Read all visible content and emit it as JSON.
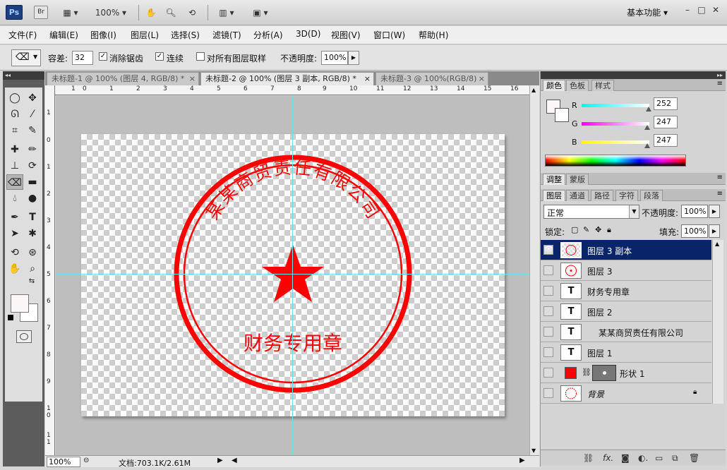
{
  "appbar": {
    "ps_logo": "Ps",
    "br_logo": "Br",
    "zoom": "100%",
    "workspace": "基本功能"
  },
  "menu": [
    "文件(F)",
    "编辑(E)",
    "图像(I)",
    "图层(L)",
    "选择(S)",
    "滤镜(T)",
    "分析(A)",
    "3D(D)",
    "视图(V)",
    "窗口(W)",
    "帮助(H)"
  ],
  "options": {
    "tolerance_label": "容差:",
    "tolerance_value": "32",
    "antialias_label": "消除锯齿",
    "contiguous_label": "连续",
    "sample_all_label": "对所有图层取样",
    "opacity_label": "不透明度:",
    "opacity_value": "100%"
  },
  "doc_tabs": [
    "未标题-1 @ 100% (图层 4, RGB/8) *",
    "未标题-2 @ 100% (图层 3 副本, RGB/8) *",
    "未标题-3 @ 100%(RGB/8)"
  ],
  "ruler_h": [
    "1",
    "0",
    "1",
    "2",
    "3",
    "4",
    "5",
    "6",
    "7",
    "8",
    "9",
    "10",
    "11",
    "12",
    "13",
    "14",
    "15",
    "16"
  ],
  "ruler_v": [
    "1",
    "0",
    "1",
    "2",
    "3",
    "4",
    "5",
    "6",
    "7",
    "8",
    "9",
    "1 0",
    "1 1"
  ],
  "stamp": {
    "company": "某某商贸责任有限公司",
    "purpose": "财务专用章",
    "color": "#ff0000"
  },
  "status": {
    "zoom": "100%",
    "doc": "文档:703.1K/2.61M"
  },
  "color_panel": {
    "tabs": [
      "颜色",
      "色板",
      "样式"
    ],
    "r_label": "R",
    "g_label": "G",
    "b_label": "B",
    "r": "252",
    "g": "247",
    "b": "247",
    "r_level": 0.988,
    "g_level": 0.969,
    "b_level": 0.969
  },
  "adjust_tabs": [
    "调整",
    "蒙版"
  ],
  "layers_panel": {
    "tabs": [
      "图层",
      "通道",
      "路径",
      "字符",
      "段落"
    ],
    "blend_mode": "正常",
    "opacity_label": "不透明度:",
    "opacity": "100%",
    "lock_label": "锁定:",
    "fill_label": "填充:",
    "fill": "100%",
    "layers": [
      {
        "name": "图层 3 副本",
        "thumb": "",
        "kind": "raster",
        "visible": true,
        "selected": true
      },
      {
        "name": "图层 3",
        "thumb": "",
        "kind": "raster",
        "visible": false,
        "selected": false
      },
      {
        "name": "财务专用章",
        "thumb": "T",
        "kind": "text",
        "visible": false,
        "selected": false
      },
      {
        "name": "图层 2",
        "thumb": "T",
        "kind": "text",
        "visible": false,
        "selected": false
      },
      {
        "name": "某某商贸责任有限公司",
        "thumb": "T",
        "kind": "text",
        "visible": false,
        "selected": false
      },
      {
        "name": "图层 1",
        "thumb": "T",
        "kind": "text",
        "visible": false,
        "selected": false
      },
      {
        "name": "形状 1",
        "thumb": "",
        "kind": "shape",
        "visible": false,
        "selected": false
      },
      {
        "name": "背景",
        "thumb": "",
        "kind": "background",
        "visible": false,
        "selected": false
      }
    ]
  }
}
